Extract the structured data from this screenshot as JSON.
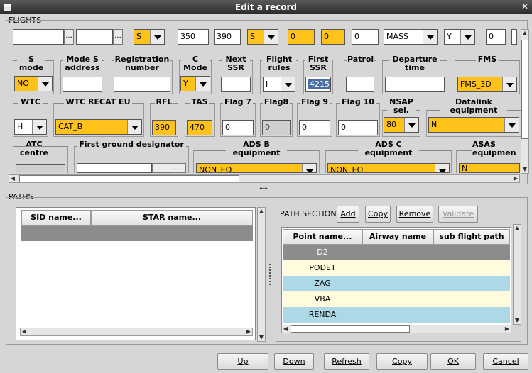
{
  "window": {
    "title": "Edit a record"
  },
  "flights": {
    "section_label": "FLIGHTS",
    "row0": {
      "f1": "",
      "f2": "",
      "dd1": "S",
      "f3": "350",
      "f4": "390",
      "dd2": "S",
      "f5": "0",
      "f6": "0",
      "f7": "0",
      "dd3": "MASS",
      "dd4": "Y",
      "f8": "0"
    },
    "row1": {
      "s_mode_label": "S mode",
      "s_mode_value": "NO",
      "mode_s_address_label": "Mode S address",
      "mode_s_address_value": "",
      "registration_label": "Registration number",
      "registration_value": "",
      "c_mode_label": "C Mode",
      "c_mode_value": "Y",
      "next_ssr_label": "Next SSR",
      "next_ssr_value": "",
      "flight_rules_label": "Flight rules",
      "flight_rules_value": "I",
      "first_ssr_label": "First SSR",
      "first_ssr_value": "4215",
      "patrol_label": "Patrol",
      "patrol_value": "",
      "departure_time_label": "Departure time",
      "departure_time_value": "",
      "fms_label": "FMS",
      "fms_value": "FMS_3D"
    },
    "row2": {
      "wtc_label": "WTC",
      "wtc_value": "H",
      "wtc_recat_label": "WTC RECAT EU",
      "wtc_recat_value": "CAT_B",
      "rfl_label": "RFL",
      "rfl_value": "390",
      "tas_label": "TAS",
      "tas_value": "470",
      "flag7_label": "Flag 7",
      "flag7_value": "0",
      "flag8_label": "Flag8",
      "flag8_value": "0",
      "flag9_label": "Flag 9",
      "flag9_value": "0",
      "flag10_label": "Flag 10",
      "flag10_value": "0",
      "nsap_label": "NSAP sel.",
      "nsap_value": "80",
      "datalink_label": "Datalink equipment",
      "datalink_value": "N"
    },
    "row3": {
      "atc_label": "ATC centre",
      "first_ground_label": "First ground designator",
      "adsb_label": "ADS B equipment",
      "adsb_value": "NON_EQ",
      "adsc_label": "ADS C equipment",
      "adsc_value": "NON_EQ",
      "asas_label": "ASAS equipmen",
      "asas_value": "N"
    }
  },
  "splitter": "......",
  "paths": {
    "section_label": "PATHS",
    "columns": [
      "SID name...",
      "STAR name..."
    ],
    "path_section": {
      "label": "PATH SECTION",
      "buttons": {
        "add": "Add",
        "copy": "Copy",
        "remove": "Remove",
        "validate": "Validate"
      },
      "columns": [
        "Point name...",
        "Airway name",
        "sub flight path"
      ],
      "rows": [
        {
          "point": "D2",
          "airway": "",
          "sub": ""
        },
        {
          "point": "PODET",
          "airway": "",
          "sub": ""
        },
        {
          "point": "ZAG",
          "airway": "",
          "sub": ""
        },
        {
          "point": "VBA",
          "airway": "",
          "sub": ""
        },
        {
          "point": "RENDA",
          "airway": "",
          "sub": ""
        }
      ]
    }
  },
  "footer": {
    "up": "Up",
    "down": "Down",
    "refresh": "Refresh",
    "copy": "Copy",
    "ok": "OK",
    "cancel": "Cancel"
  },
  "colors": {
    "yellow_field": "#ffc21a",
    "row_selected": "#8c8c8c",
    "row_yellow": "#fffbdc",
    "row_blue": "#add8e6",
    "highlight": "#4a6fa5"
  }
}
